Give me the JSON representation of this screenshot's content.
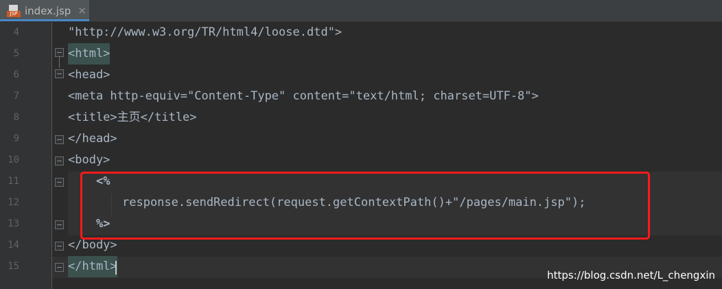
{
  "tab": {
    "title": "index.jsp",
    "close": "✕",
    "icon": "jsp-file-icon",
    "icon_label": "JSP"
  },
  "lines": [
    {
      "num": "4",
      "code": "\"http://www.w3.org/TR/html4/loose.dtd\">"
    },
    {
      "num": "5",
      "code": "<html>"
    },
    {
      "num": "6",
      "code": "<head>"
    },
    {
      "num": "7",
      "code": "<meta http-equiv=\"Content-Type\" content=\"text/html; charset=UTF-8\">"
    },
    {
      "num": "8",
      "code": "<title>主页</title>"
    },
    {
      "num": "9",
      "code": "</head>"
    },
    {
      "num": "10",
      "code": "<body>"
    },
    {
      "num": "11",
      "code": "<%"
    },
    {
      "num": "12",
      "code": "response.sendRedirect(request.getContextPath()+\"/pages/main.jsp\");"
    },
    {
      "num": "13",
      "code": "%>"
    },
    {
      "num": "14",
      "code": "</body>"
    },
    {
      "num": "15",
      "code": "</html>"
    }
  ],
  "watermark": "https://blog.csdn.net/L_chengxin",
  "colors": {
    "highlight_box": "#ff1a1a",
    "tag": "#e8bf6a",
    "string": "#6a8759",
    "jsp_delim": "#cc7832"
  }
}
